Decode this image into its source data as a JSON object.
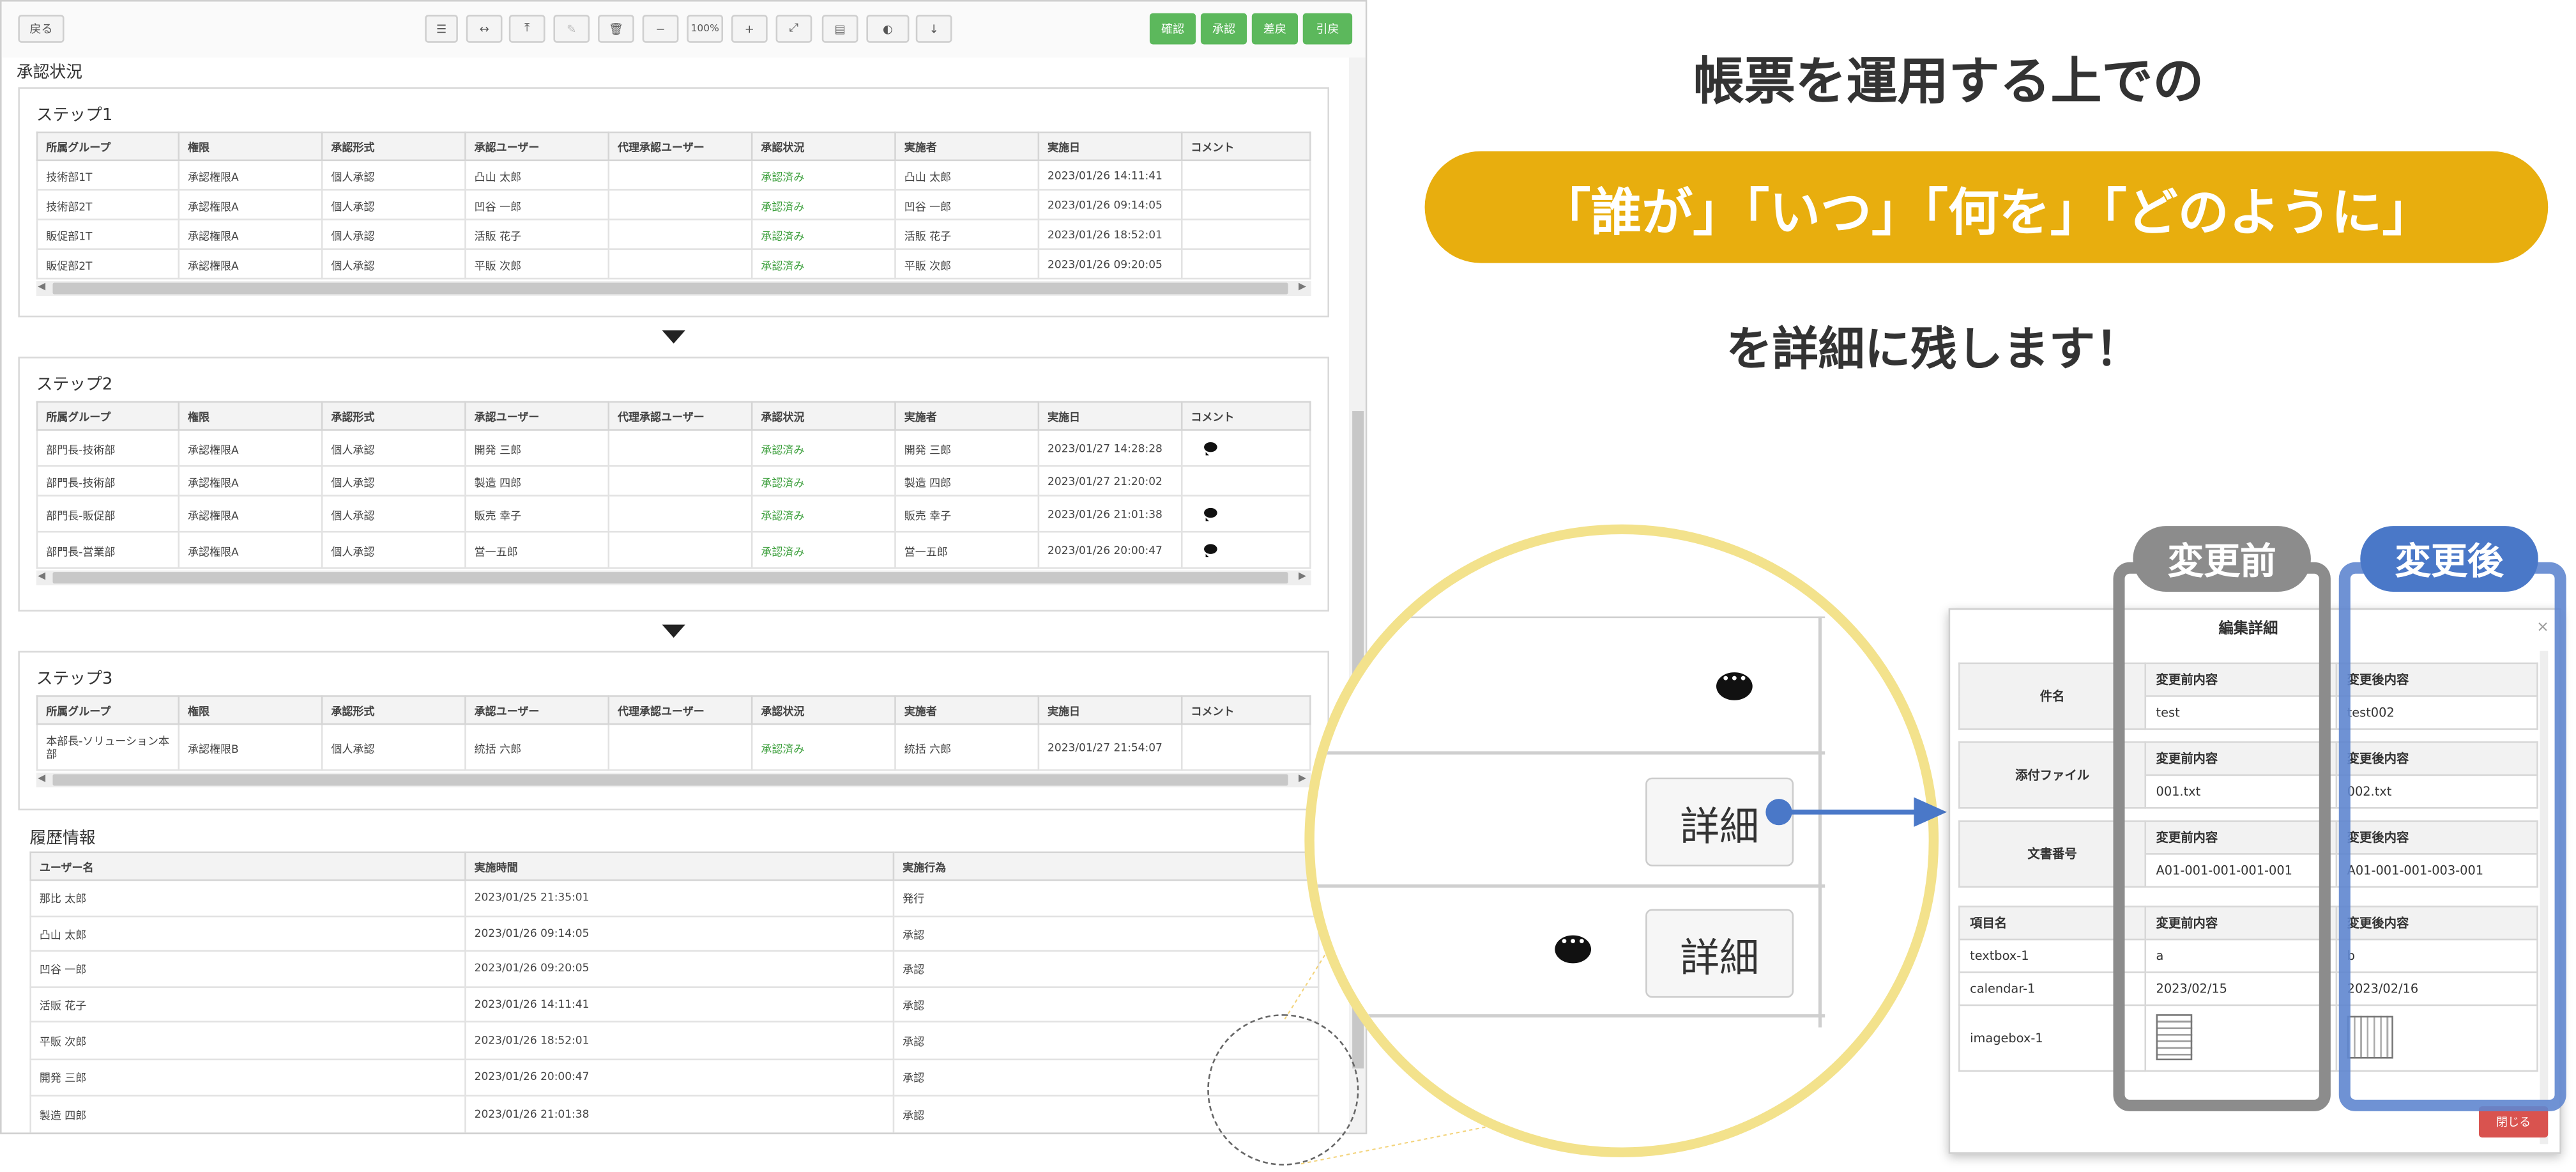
{
  "toolbar": {
    "back_label": "戻る",
    "zoom_label": "100%",
    "actions": [
      "確認",
      "承認",
      "差戻",
      "引戻"
    ]
  },
  "approval": {
    "title": "承認状況",
    "columns": [
      "所属グループ",
      "権限",
      "承認形式",
      "承認ユーザー",
      "代理承認ユーザー",
      "承認状況",
      "実施者",
      "実施日",
      "コメント"
    ],
    "steps": [
      {
        "title": "ステップ1",
        "rows": [
          [
            "技術部1T",
            "承認権限A",
            "個人承認",
            "凸山 太郎",
            "",
            "承認済み",
            "凸山 太郎",
            "2023/01/26 14:11:41",
            ""
          ],
          [
            "技術部2T",
            "承認権限A",
            "個人承認",
            "凹谷 一郎",
            "",
            "承認済み",
            "凹谷 一郎",
            "2023/01/26 09:14:05",
            ""
          ],
          [
            "販促部1T",
            "承認権限A",
            "個人承認",
            "活販 花子",
            "",
            "承認済み",
            "活販 花子",
            "2023/01/26 18:52:01",
            ""
          ],
          [
            "販促部2T",
            "承認権限A",
            "個人承認",
            "平販 次郎",
            "",
            "承認済み",
            "平販 次郎",
            "2023/01/26 09:20:05",
            ""
          ]
        ]
      },
      {
        "title": "ステップ2",
        "rows": [
          [
            "部門長-技術部",
            "承認権限A",
            "個人承認",
            "開発 三郎",
            "",
            "承認済み",
            "開発 三郎",
            "2023/01/27 14:28:28",
            "comment"
          ],
          [
            "部門長-技術部",
            "承認権限A",
            "個人承認",
            "製造 四郎",
            "",
            "承認済み",
            "製造 四郎",
            "2023/01/27 21:20:02",
            ""
          ],
          [
            "部門長-販促部",
            "承認権限A",
            "個人承認",
            "販売 幸子",
            "",
            "承認済み",
            "販売 幸子",
            "2023/01/26 21:01:38",
            "comment"
          ],
          [
            "部門長-営業部",
            "承認権限A",
            "個人承認",
            "営一五郎",
            "",
            "承認済み",
            "営一五郎",
            "2023/01/26 20:00:47",
            "comment"
          ]
        ]
      },
      {
        "title": "ステップ3",
        "rows": [
          [
            "本部長-ソリューション本部",
            "承認権限B",
            "個人承認",
            "統括 六郎",
            "",
            "承認済み",
            "統括 六郎",
            "2023/01/27 21:54:07",
            ""
          ]
        ]
      }
    ]
  },
  "history": {
    "title": "履歴情報",
    "columns": [
      "ユーザー名",
      "実施時間",
      "実施行為"
    ],
    "rows": [
      [
        "那比 太郎",
        "2023/01/25 21:35:01",
        "発行",
        ""
      ],
      [
        "凸山 太郎",
        "2023/01/26 09:14:05",
        "承認",
        ""
      ],
      [
        "凹谷 一郎",
        "2023/01/26 09:20:05",
        "承認",
        ""
      ],
      [
        "活販 花子",
        "2023/01/26 14:11:41",
        "承認",
        ""
      ],
      [
        "平販 次郎",
        "2023/01/26 18:52:01",
        "承認",
        "comment"
      ],
      [
        "開発 三郎",
        "2023/01/26 20:00:47",
        "承認",
        "detail"
      ],
      [
        "製造 四郎",
        "2023/01/26 21:01:38",
        "承認",
        "comment+detail"
      ]
    ],
    "detail_label": "詳細"
  },
  "promo": {
    "line1": "帳票を運用する上での",
    "pill": "「誰が」「いつ」「何を」「どのように」",
    "line3": "を詳細に残します！",
    "pill_color": "#e8ae0e"
  },
  "zoom": {
    "detail_label": "詳細",
    "ring_color": "#f3e28c"
  },
  "dialog": {
    "title": "編集詳細",
    "tag_before": "変更前",
    "tag_after": "変更後",
    "tag_before_color": "#8c8c8c",
    "tag_after_color": "#4a78c8",
    "before_header": "変更前内容",
    "after_header": "変更後内容",
    "fields": [
      {
        "label": "件名",
        "before": "test",
        "after": "test002"
      },
      {
        "label": "添付ファイル",
        "before": "001.txt",
        "after": "002.txt"
      },
      {
        "label": "文書番号",
        "before": "A01-001-001-001-001",
        "after": "A01-001-001-003-001"
      }
    ],
    "items_header": "項目名",
    "items": [
      {
        "label": "textbox-1",
        "before": "a",
        "after": "b"
      },
      {
        "label": "calendar-1",
        "before": "2023/02/15",
        "after": "2023/02/16"
      },
      {
        "label": "imagebox-1",
        "before": "",
        "after": ""
      }
    ],
    "close_label": "閉じる",
    "close_color": "#d9534f"
  }
}
